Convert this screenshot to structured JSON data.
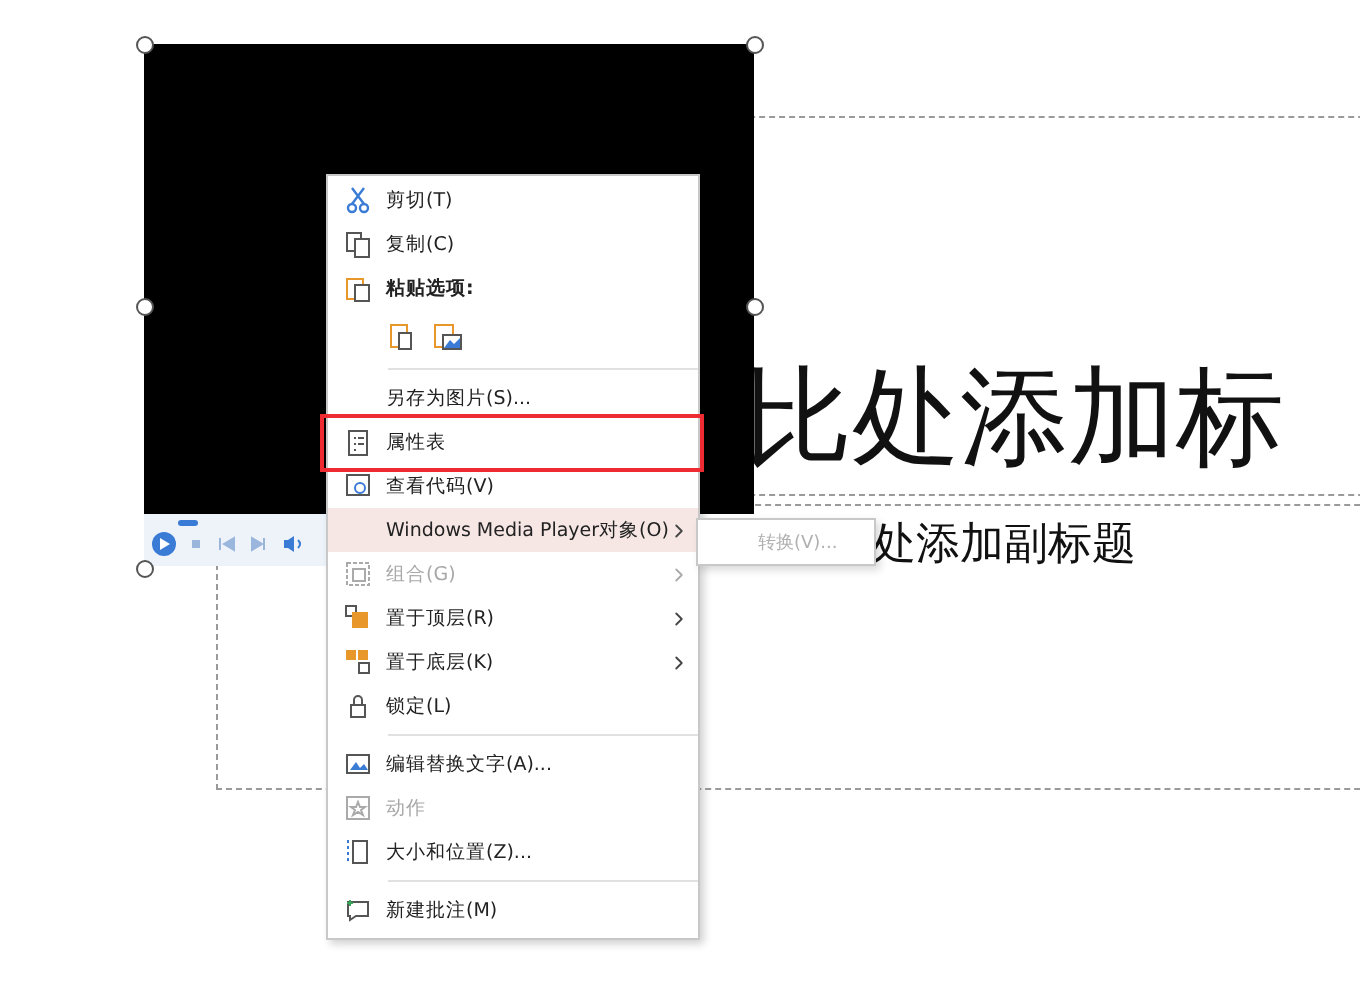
{
  "slide": {
    "title": "比处添加标",
    "subtitle": "处添加副标题"
  },
  "context_menu": {
    "items": [
      {
        "kind": "item",
        "label": "剪切(T)",
        "disabled": false,
        "selected": false,
        "submenu": false
      },
      {
        "kind": "item",
        "label": "复制(C)",
        "disabled": false,
        "selected": false,
        "submenu": false
      },
      {
        "kind": "header",
        "label": "粘贴选项:",
        "disabled": false,
        "selected": false,
        "submenu": false
      },
      {
        "kind": "paste-options"
      },
      {
        "kind": "separator"
      },
      {
        "kind": "item",
        "label": "另存为图片(S)...",
        "disabled": false,
        "selected": false,
        "submenu": false
      },
      {
        "kind": "item",
        "label": "属性表",
        "disabled": false,
        "selected": false,
        "submenu": false
      },
      {
        "kind": "item",
        "label": "查看代码(V)",
        "disabled": false,
        "selected": false,
        "submenu": false
      },
      {
        "kind": "item",
        "label": "Windows Media Player对象(O)",
        "disabled": false,
        "selected": true,
        "submenu": true
      },
      {
        "kind": "item",
        "label": "组合(G)",
        "disabled": true,
        "selected": false,
        "submenu": true
      },
      {
        "kind": "item",
        "label": "置于顶层(R)",
        "disabled": false,
        "selected": false,
        "submenu": true
      },
      {
        "kind": "item",
        "label": "置于底层(K)",
        "disabled": false,
        "selected": false,
        "submenu": true
      },
      {
        "kind": "item",
        "label": "锁定(L)",
        "disabled": false,
        "selected": false,
        "submenu": false
      },
      {
        "kind": "separator"
      },
      {
        "kind": "item",
        "label": "编辑替换文字(A)...",
        "disabled": false,
        "selected": false,
        "submenu": false
      },
      {
        "kind": "item",
        "label": "动作",
        "disabled": true,
        "selected": false,
        "submenu": false
      },
      {
        "kind": "item",
        "label": "大小和位置(Z)...",
        "disabled": false,
        "selected": false,
        "submenu": false
      },
      {
        "kind": "separator"
      },
      {
        "kind": "item",
        "label": "新建批注(M)",
        "disabled": false,
        "selected": false,
        "submenu": false
      }
    ]
  },
  "submenu": {
    "items": [
      {
        "label": "转换(V)...",
        "disabled": true
      }
    ]
  }
}
